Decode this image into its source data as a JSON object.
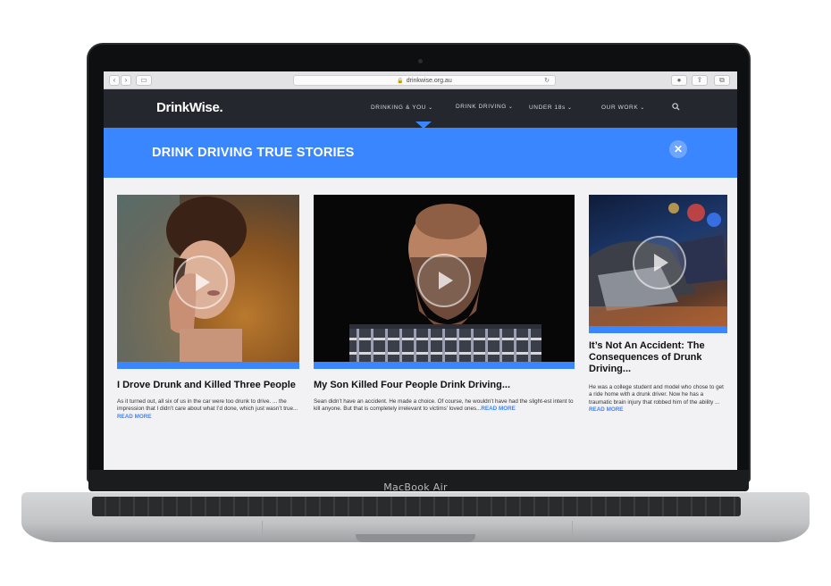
{
  "device": {
    "model_label": "MacBook Air"
  },
  "browser": {
    "url": "drinkwise.org.au"
  },
  "site": {
    "logo": "DrinkWise.",
    "nav": [
      {
        "label": "DRINKING & YOU"
      },
      {
        "label": "DRINK DRIVING"
      },
      {
        "label": "UNDER 18s"
      },
      {
        "label": "OUR WORK"
      }
    ],
    "search_icon": "search-icon"
  },
  "band": {
    "title": "DRINK DRIVING TRUE STORIES",
    "close_icon": "close-icon",
    "color": "#3a86ff"
  },
  "stories": [
    {
      "title": "I Drove Drunk and Killed Three People",
      "excerpt": "As it turned out, all six of us in the car were too drunk to drive. ... the impression that I didn’t care about what I’d done, which just wasn’t true...",
      "read_more": "READ MORE"
    },
    {
      "title": "My Son Killed Four People Drink Driving...",
      "excerpt": "Sean didn’t have an accident. He made a choice. Of course, he wouldn’t have had the slight-est intent to kill anyone. But that is completely irrelevant to victims’ loved ones...",
      "read_more": "READ MORE"
    },
    {
      "title": "It’s Not An Accident: The Consequences of Drunk Driving...",
      "excerpt": "He was a college student and model who chose to get a ride home with a drunk driver. Now he has a traumatic brain injury that robbed him of the ability ...",
      "read_more": "READ MORE"
    }
  ]
}
